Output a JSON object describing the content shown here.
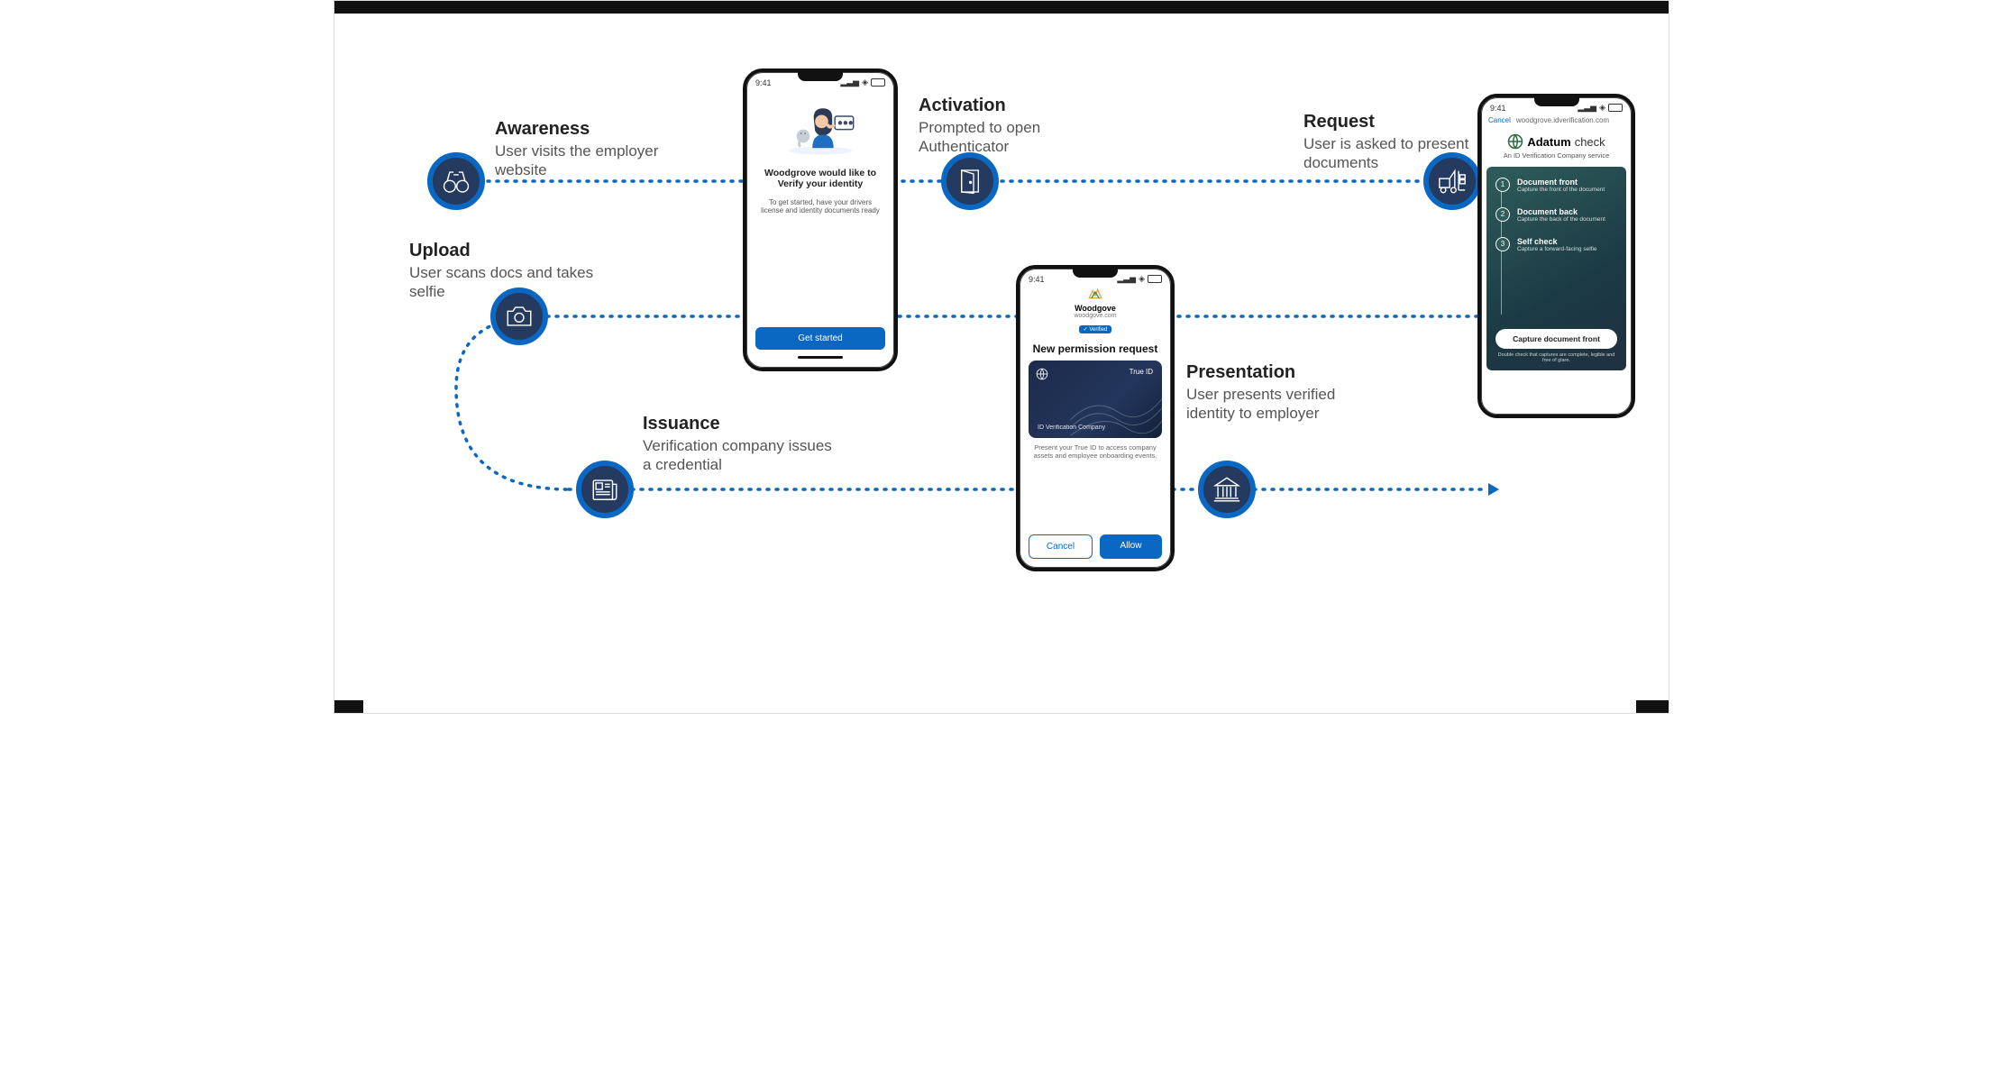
{
  "steps": {
    "awareness": {
      "title": "Awareness",
      "desc": "User visits the employer website"
    },
    "activation": {
      "title": "Activation",
      "desc": "Prompted to open Authenticator"
    },
    "request": {
      "title": "Request",
      "desc": "User is asked to present documents"
    },
    "upload": {
      "title": "Upload",
      "desc": "User scans docs and takes selfie"
    },
    "issuance": {
      "title": "Issuance",
      "desc": "Verification company issues a credential"
    },
    "presentation": {
      "title": "Presentation",
      "desc": "User presents verified identity to employer"
    }
  },
  "phone_time": "9:41",
  "phone1": {
    "heading": "Woodgrove would like to Verify your identity",
    "instruction": "To get started, have your drivers license and identity documents ready",
    "button": "Get started"
  },
  "phone2": {
    "cancel": "Cancel",
    "url": "woodgrove.idverification.com",
    "brand_left": "Adatum",
    "brand_right": "check",
    "subtitle": "An ID Verification Company service",
    "step1_title": "Document front",
    "step1_desc": "Capture the front of the document",
    "step2_title": "Document back",
    "step2_desc": "Capture the back of the document",
    "step3_title": "Self check",
    "step3_desc": "Capture a forward-facing selfie",
    "cta": "Capture document front",
    "footnote": "Double check that captures are complete, legible and free of glare."
  },
  "phone3": {
    "brand": "Woodgove",
    "domain": "woodgove.com",
    "verified": "✓ Verified",
    "heading": "New permission request",
    "card_title": "True ID",
    "card_issuer": "ID Verification Company",
    "explain": "Present your True ID to access company assets and employee onboarding events.",
    "cancel": "Cancel",
    "allow": "Allow"
  }
}
